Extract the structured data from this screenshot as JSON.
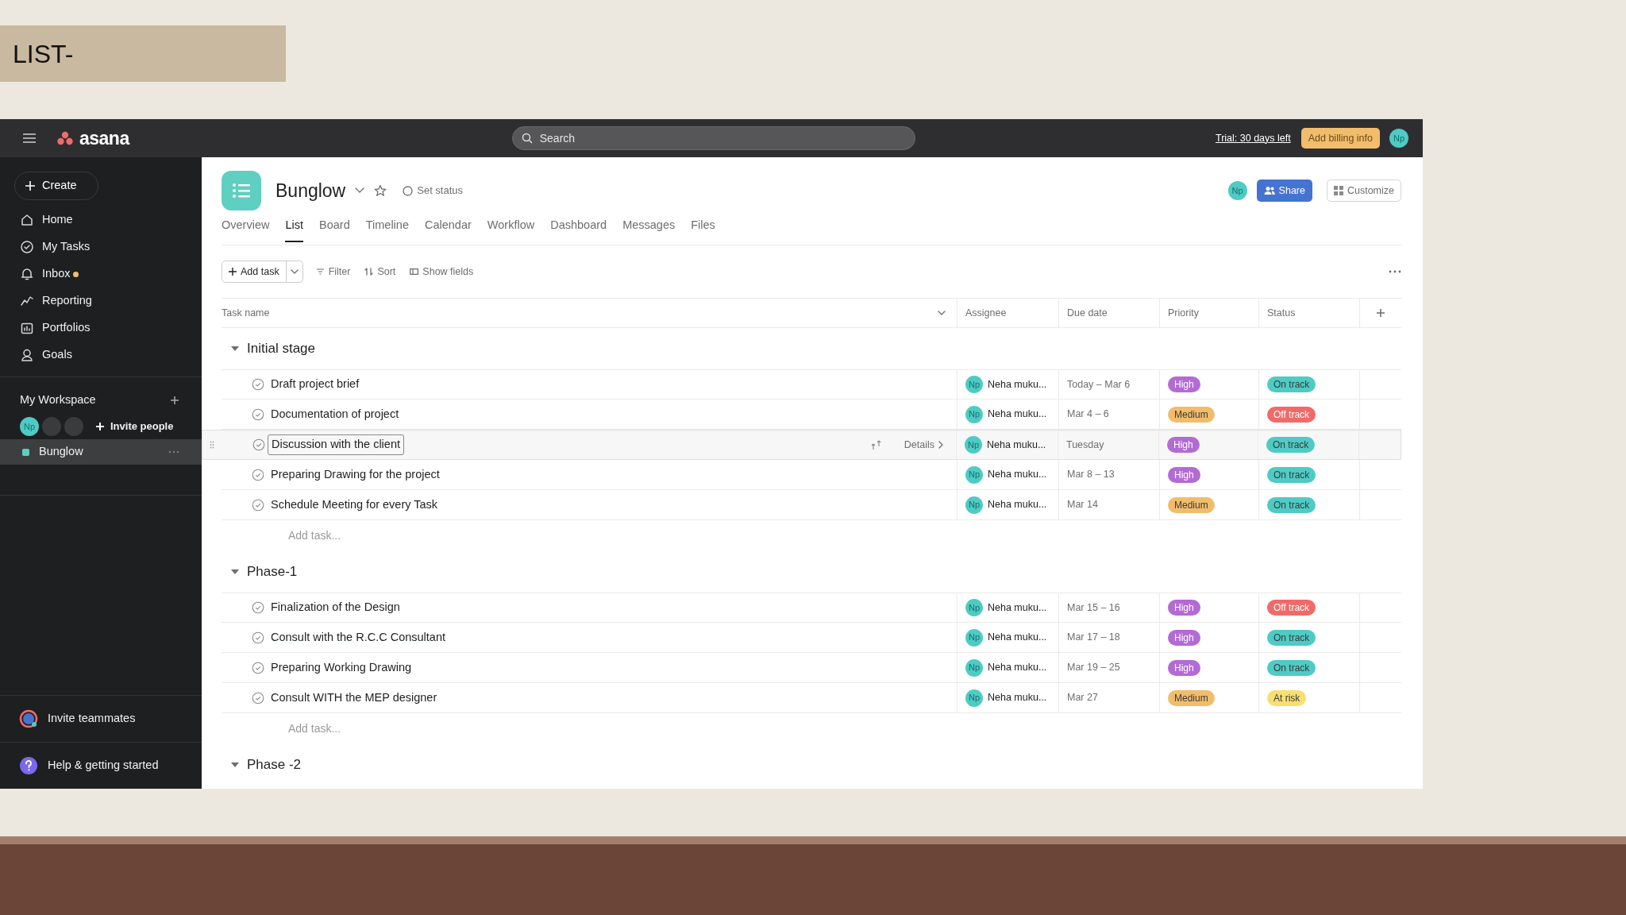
{
  "slide_title": "LIST-",
  "topbar": {
    "logo": "asana",
    "search_placeholder": "Search",
    "trial": "Trial: 30 days left",
    "billing": "Add billing info",
    "avatar": "Np"
  },
  "sidebar": {
    "create": "Create",
    "nav": [
      {
        "label": "Home",
        "unread": false
      },
      {
        "label": "My Tasks",
        "unread": false
      },
      {
        "label": "Inbox",
        "unread": true
      },
      {
        "label": "Reporting",
        "unread": false
      },
      {
        "label": "Portfolios",
        "unread": false
      },
      {
        "label": "Goals",
        "unread": false
      }
    ],
    "workspace": {
      "title": "My Workspace",
      "members": [
        {
          "kind": "user",
          "initials": "Np"
        },
        {
          "kind": "placeholder"
        },
        {
          "kind": "placeholder"
        }
      ],
      "invite": "Invite people"
    },
    "projects": [
      {
        "name": "Bunglow",
        "color": "#5ecfc0",
        "selected": true
      }
    ],
    "invite_teammates": "Invite teammates",
    "help": "Help & getting started"
  },
  "project": {
    "name": "Bunglow",
    "set_status": "Set status",
    "avatar": "Np",
    "share": "Share",
    "customize": "Customize",
    "tabs": [
      {
        "label": "Overview",
        "selected": false
      },
      {
        "label": "List",
        "selected": true
      },
      {
        "label": "Board",
        "selected": false
      },
      {
        "label": "Timeline",
        "selected": false
      },
      {
        "label": "Calendar",
        "selected": false
      },
      {
        "label": "Workflow",
        "selected": false
      },
      {
        "label": "Dashboard",
        "selected": false
      },
      {
        "label": "Messages",
        "selected": false
      },
      {
        "label": "Files",
        "selected": false
      }
    ],
    "toolbar": {
      "add_task": "Add task",
      "filter": "Filter",
      "sort": "Sort",
      "show_fields": "Show fields"
    },
    "columns": [
      "Task name",
      "Assignee",
      "Due date",
      "Priority",
      "Status"
    ],
    "sections": [
      {
        "title": "Initial stage",
        "expanded": true,
        "add_task": "Add task...",
        "tasks": [
          {
            "name": "Draft project brief",
            "avatar": "Np",
            "assignee": "Neha muku...",
            "due": "Today – Mar 6",
            "priority": {
              "label": "High",
              "color": "#b36bd4"
            },
            "status": {
              "label": "On track",
              "color": "#4ecbc4"
            },
            "highlighted": false
          },
          {
            "name": "Documentation of project",
            "avatar": "Np",
            "assignee": "Neha muku...",
            "due": "Mar 4 – 6",
            "priority": {
              "label": "Medium",
              "color": "#f1bd6c"
            },
            "status": {
              "label": "Off track",
              "color": "#f06a6a"
            },
            "highlighted": false
          },
          {
            "name": "Discussion with the client",
            "avatar": "Np",
            "assignee": "Neha muku...",
            "due": "Tuesday",
            "priority": {
              "label": "High",
              "color": "#b36bd4"
            },
            "status": {
              "label": "On track",
              "color": "#4ecbc4"
            },
            "highlighted": true,
            "details": "Details"
          },
          {
            "name": "Preparing Drawing for the project",
            "avatar": "Np",
            "assignee": "Neha muku...",
            "due": "Mar 8 – 13",
            "priority": {
              "label": "High",
              "color": "#b36bd4"
            },
            "status": {
              "label": "On track",
              "color": "#4ecbc4"
            },
            "highlighted": false
          },
          {
            "name": "Schedule Meeting for every Task",
            "avatar": "Np",
            "assignee": "Neha muku...",
            "due": "Mar 14",
            "priority": {
              "label": "Medium",
              "color": "#f1bd6c"
            },
            "status": {
              "label": "On track",
              "color": "#4ecbc4"
            },
            "highlighted": false
          }
        ]
      },
      {
        "title": "Phase-1",
        "expanded": true,
        "add_task": "Add task...",
        "tasks": [
          {
            "name": "Finalization of the Design",
            "avatar": "Np",
            "assignee": "Neha muku...",
            "due": "Mar 15 – 16",
            "priority": {
              "label": "High",
              "color": "#b36bd4"
            },
            "status": {
              "label": "Off track",
              "color": "#f06a6a"
            },
            "highlighted": false
          },
          {
            "name": "Consult with the R.C.C Consultant",
            "avatar": "Np",
            "assignee": "Neha muku...",
            "due": "Mar 17 – 18",
            "priority": {
              "label": "High",
              "color": "#b36bd4"
            },
            "status": {
              "label": "On track",
              "color": "#4ecbc4"
            },
            "highlighted": false
          },
          {
            "name": "Preparing Working Drawing",
            "avatar": "Np",
            "assignee": "Neha muku...",
            "due": "Mar 19 – 25",
            "priority": {
              "label": "High",
              "color": "#b36bd4"
            },
            "status": {
              "label": "On track",
              "color": "#4ecbc4"
            },
            "highlighted": false
          },
          {
            "name": "Consult WITH the MEP designer",
            "avatar": "Np",
            "assignee": "Neha muku...",
            "due": "Mar 27",
            "priority": {
              "label": "Medium",
              "color": "#f1bd6c"
            },
            "status": {
              "label": "At risk",
              "color": "#f8df72"
            },
            "highlighted": false
          }
        ]
      },
      {
        "title": "Phase -2",
        "expanded": true
      }
    ]
  }
}
